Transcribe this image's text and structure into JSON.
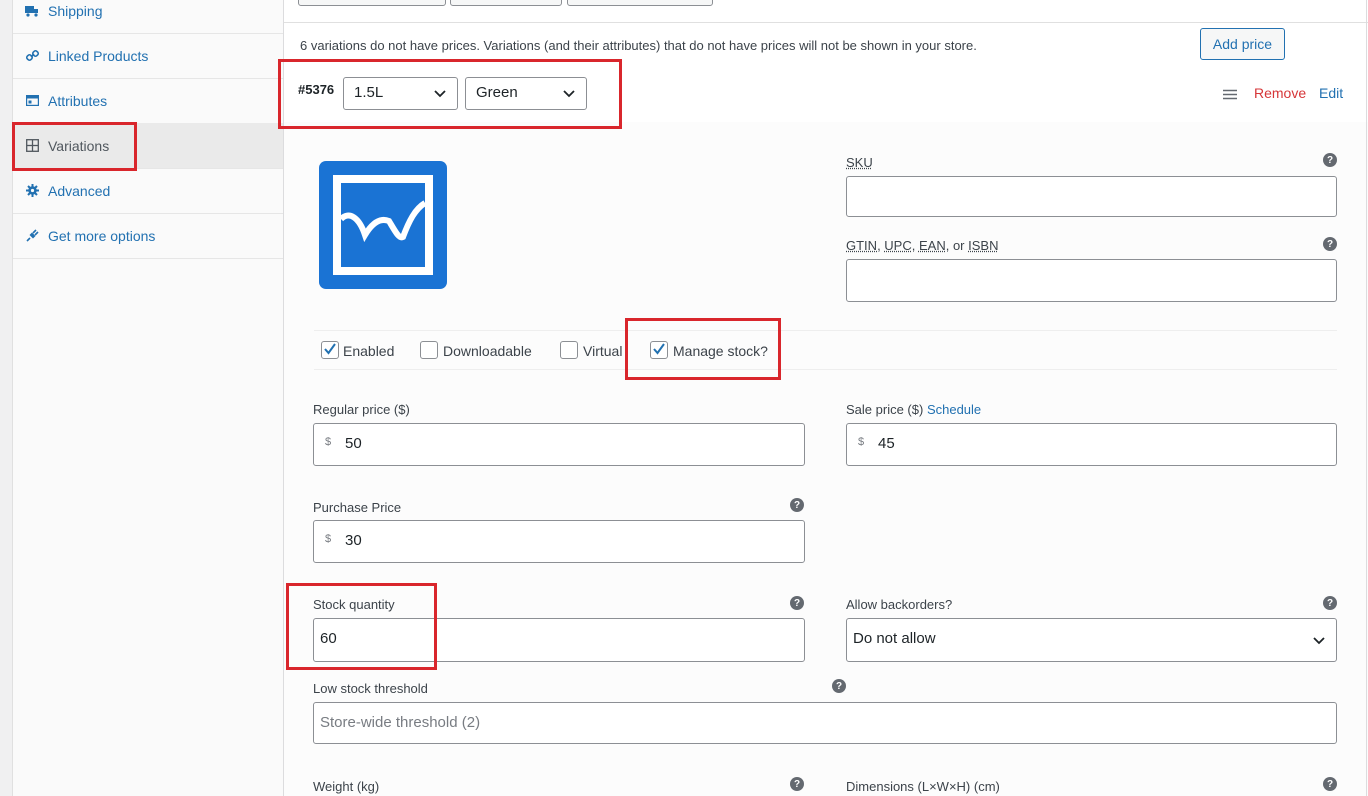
{
  "sidebar": {
    "items": [
      {
        "label": "Shipping",
        "icon": "truck-icon"
      },
      {
        "label": "Linked Products",
        "icon": "link-icon"
      },
      {
        "label": "Attributes",
        "icon": "table-icon"
      },
      {
        "label": "Variations",
        "icon": "grid-icon"
      },
      {
        "label": "Advanced",
        "icon": "gear-icon"
      },
      {
        "label": "Get more options",
        "icon": "plugin-icon"
      }
    ]
  },
  "notice": {
    "text": "6 variations do not have prices. Variations (and their attributes) that do not have prices will not be shown in your store.",
    "add_price_label": "Add price"
  },
  "variation": {
    "id": "#5376",
    "size": "1.5L",
    "color": "Green",
    "remove_label": "Remove",
    "edit_label": "Edit"
  },
  "fields": {
    "sku_label": "SKU",
    "gtin_label_parts": [
      "GTIN",
      ", ",
      "UPC",
      ", ",
      "EAN",
      ", or ",
      "ISBN"
    ],
    "enabled_label": "Enabled",
    "downloadable_label": "Downloadable",
    "virtual_label": "Virtual",
    "manage_stock_label": "Manage stock?",
    "regular_price_label": "Regular price ($)",
    "regular_price_value": "50",
    "sale_price_label": "Sale price ($)",
    "schedule_label": "Schedule",
    "sale_price_value": "45",
    "currency": "$",
    "purchase_price_label": "Purchase Price",
    "purchase_price_value": "30",
    "stock_qty_label": "Stock quantity",
    "stock_qty_value": "60",
    "backorders_label": "Allow backorders?",
    "backorders_value": "Do not allow",
    "low_stock_label": "Low stock threshold",
    "low_stock_placeholder": "Store-wide threshold (2)",
    "weight_label": "Weight (kg)",
    "dimensions_label": "Dimensions (L×W×H) (cm)",
    "help_glyph": "?"
  },
  "colors": {
    "accent": "#2271b1",
    "remove": "#d63638",
    "highlight_box": "#d9262c",
    "image_placeholder": "#1a73d4"
  }
}
